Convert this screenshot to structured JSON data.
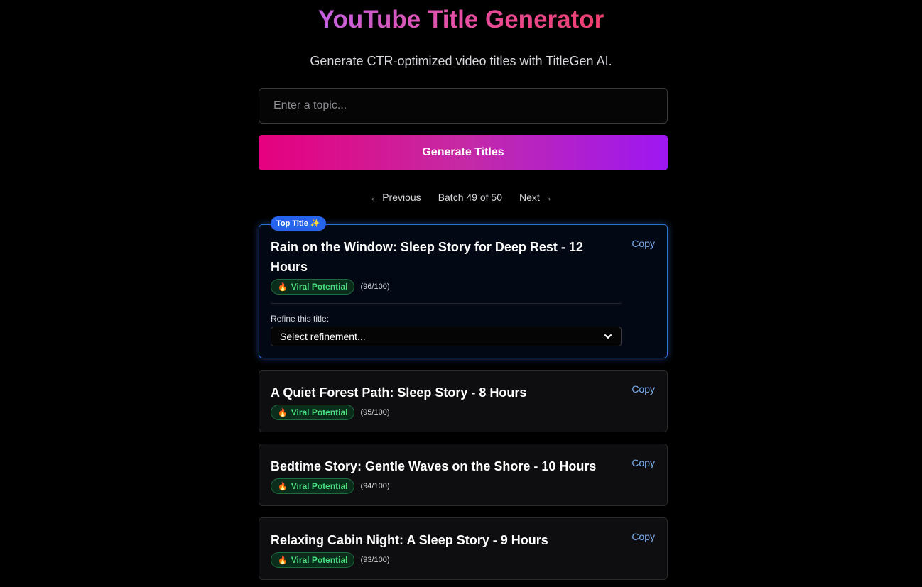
{
  "header": {
    "title": "YouTube Title Generator",
    "subtitle": "Generate CTR-optimized video titles with TitleGen AI."
  },
  "search": {
    "value": "",
    "placeholder": "Enter a topic..."
  },
  "generate_button": {
    "label": "Generate Titles"
  },
  "pagination": {
    "previous_label": "← Previous",
    "status": "Batch 49 of 50",
    "next_label": "Next →"
  },
  "top_badge": {
    "label": "Top Title ✨"
  },
  "refine": {
    "label": "Refine this title:",
    "selected": "Select refinement..."
  },
  "cards": [
    {
      "title": "Rain on the Window: Sleep Story for Deep Rest - 12 Hours",
      "badge": "Viral Potential",
      "score": "(96/100)",
      "copy_label": "Copy"
    },
    {
      "title": "A Quiet Forest Path: Sleep Story - 8 Hours",
      "badge": "Viral Potential",
      "score": "(95/100)",
      "copy_label": "Copy"
    },
    {
      "title": "Bedtime Story: Gentle Waves on the Shore - 10 Hours",
      "badge": "Viral Potential",
      "score": "(94/100)",
      "copy_label": "Copy"
    },
    {
      "title": "Relaxing Cabin Night: A Sleep Story - 9 Hours",
      "badge": "Viral Potential",
      "score": "(93/100)",
      "copy_label": "Copy"
    }
  ],
  "colors": {
    "accent_pink": "#e6007e",
    "accent_purple": "#9d17f2",
    "top_border": "#2f6fd6",
    "badge_green": "#4ade80",
    "link_blue": "#7cb0f5"
  },
  "icons": {
    "badge_icon": "fire-icon",
    "select_icon": "chevron-down-icon"
  }
}
